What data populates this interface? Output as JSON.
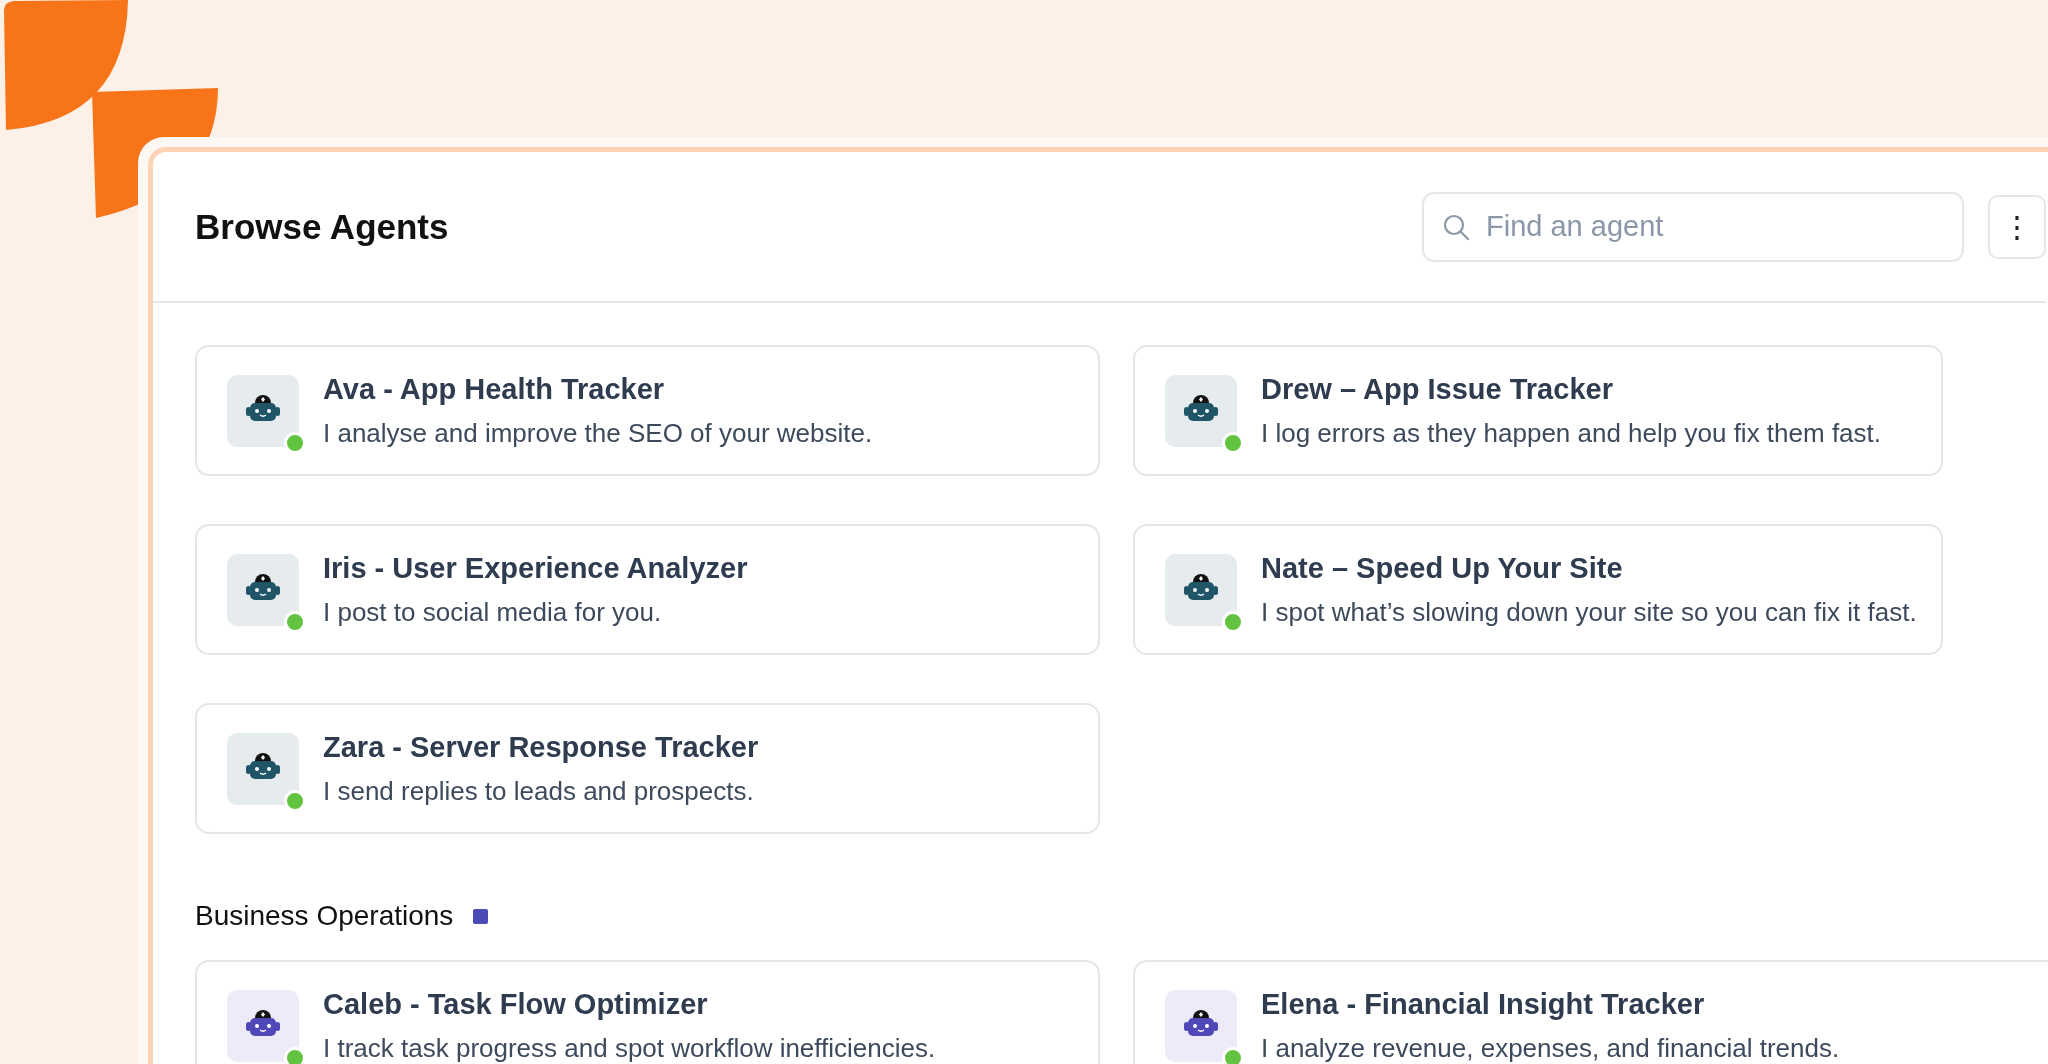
{
  "header": {
    "title": "Browse Agents"
  },
  "search": {
    "placeholder": "Find an agent"
  },
  "menu_button": {
    "label": "⋮"
  },
  "sections": [
    {
      "agents": [
        {
          "name": "Ava - App Health Tracker",
          "description": "I analyse and improve the SEO of your website.",
          "online": true,
          "color": "#1f5566"
        },
        {
          "name": "Drew – App Issue Tracker",
          "description": "I log errors as they happen and help you fix them fast.",
          "online": true,
          "color": "#1f5566"
        },
        {
          "name": "Iris - User Experience Analyzer",
          "description": "I post to social media for you.",
          "online": true,
          "color": "#1f5566"
        },
        {
          "name": "Nate – Speed Up Your Site",
          "description": "I spot what’s slowing down your site so you can fix it fast.",
          "online": true,
          "color": "#1f5566"
        },
        {
          "name": "Zara - Server Response Tracker",
          "description": "I send replies to leads and prospects.",
          "online": true,
          "color": "#1f5566"
        }
      ]
    },
    {
      "title": "Business Operations",
      "color": "#4b4bb5",
      "agents": [
        {
          "name": "Caleb - Task Flow Optimizer",
          "description": "I track task progress and spot workflow inefficiencies.",
          "online": true,
          "color": "#5048b8"
        },
        {
          "name": "Elena - Financial Insight Tracker",
          "description": "I analyze revenue, expenses, and financial trends.",
          "online": true,
          "color": "#5048b8"
        }
      ]
    }
  ]
}
